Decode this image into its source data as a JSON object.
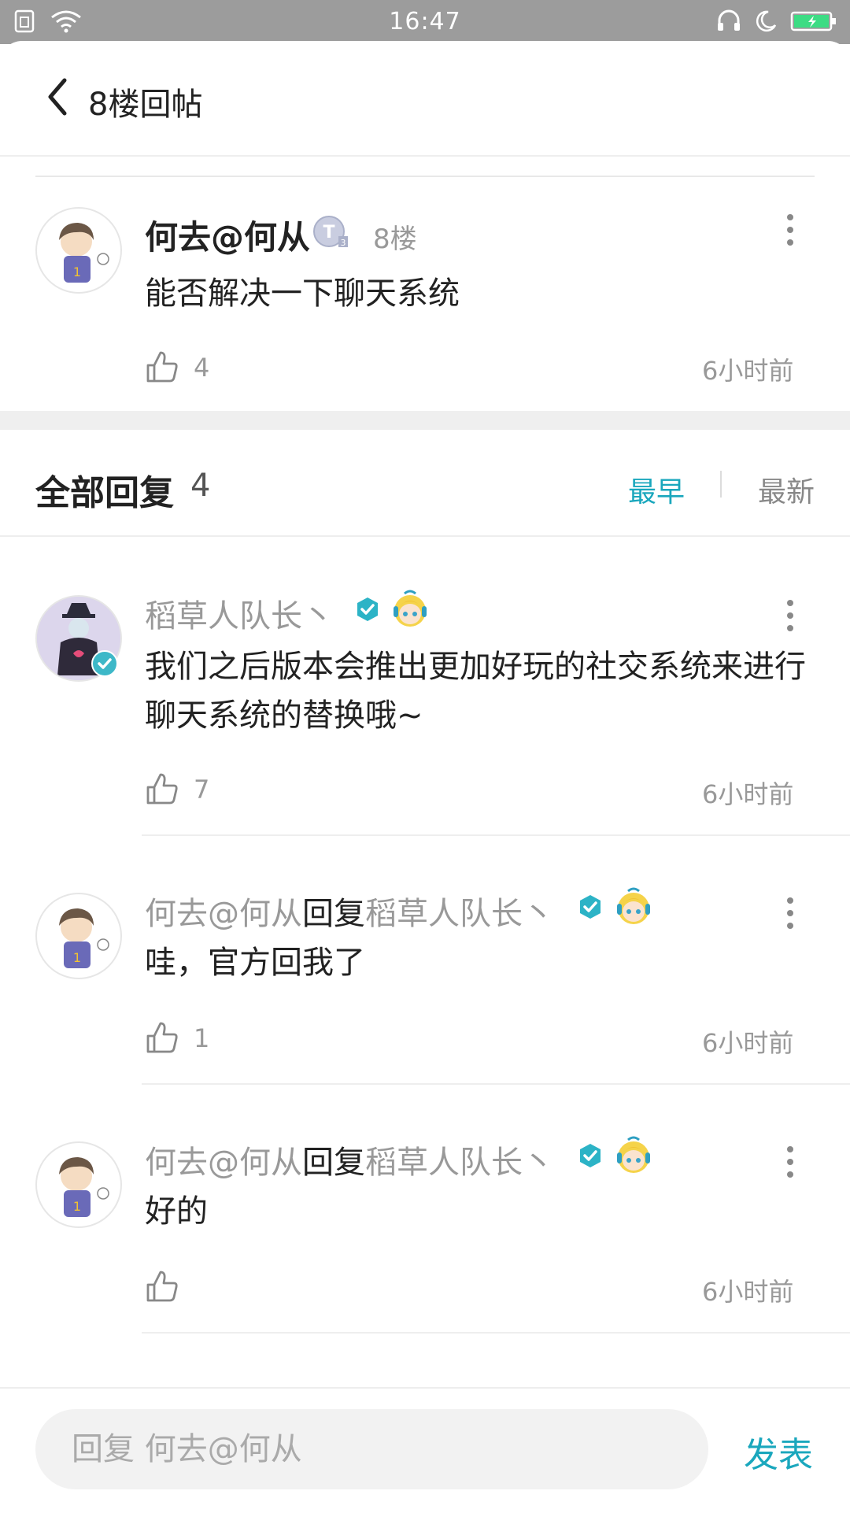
{
  "status_bar": {
    "time": "16:47"
  },
  "header": {
    "title": "8楼回帖"
  },
  "main_post": {
    "author": "何去@何从",
    "floor": "8楼",
    "content": "能否解决一下聊天系统",
    "likes": "4",
    "time": "6小时前"
  },
  "replies_header": {
    "title": "全部回复",
    "count": "4",
    "sort_earliest": "最早",
    "sort_newest": "最新"
  },
  "replies": [
    {
      "author": "稻草人队长丶",
      "content": "我们之后版本会推出更加好玩的社交系统来进行聊天系统的替换哦~",
      "likes": "7",
      "time": "6小时前"
    },
    {
      "author": "何去@何从",
      "reply_word": "回复",
      "target": "稻草人队长丶",
      "content": "哇，官方回我了",
      "likes": "1",
      "time": "6小时前"
    },
    {
      "author": "何去@何从",
      "reply_word": "回复",
      "target": "稻草人队长丶",
      "content": "好的",
      "likes": "",
      "time": "6小时前"
    }
  ],
  "reply_box": {
    "placeholder": "回复 何去@何从",
    "submit_label": "发表"
  },
  "colors": {
    "accent": "#1aa7bd",
    "status_bar": "#9c9c9c",
    "battery": "#3ddc84"
  },
  "icons": [
    "back-chevron-icon",
    "more-vertical-icon",
    "thumbs-up-icon",
    "verified-badge-icon",
    "wifi-icon",
    "battery-icon",
    "moon-icon",
    "headset-icon",
    "sim-icon"
  ]
}
